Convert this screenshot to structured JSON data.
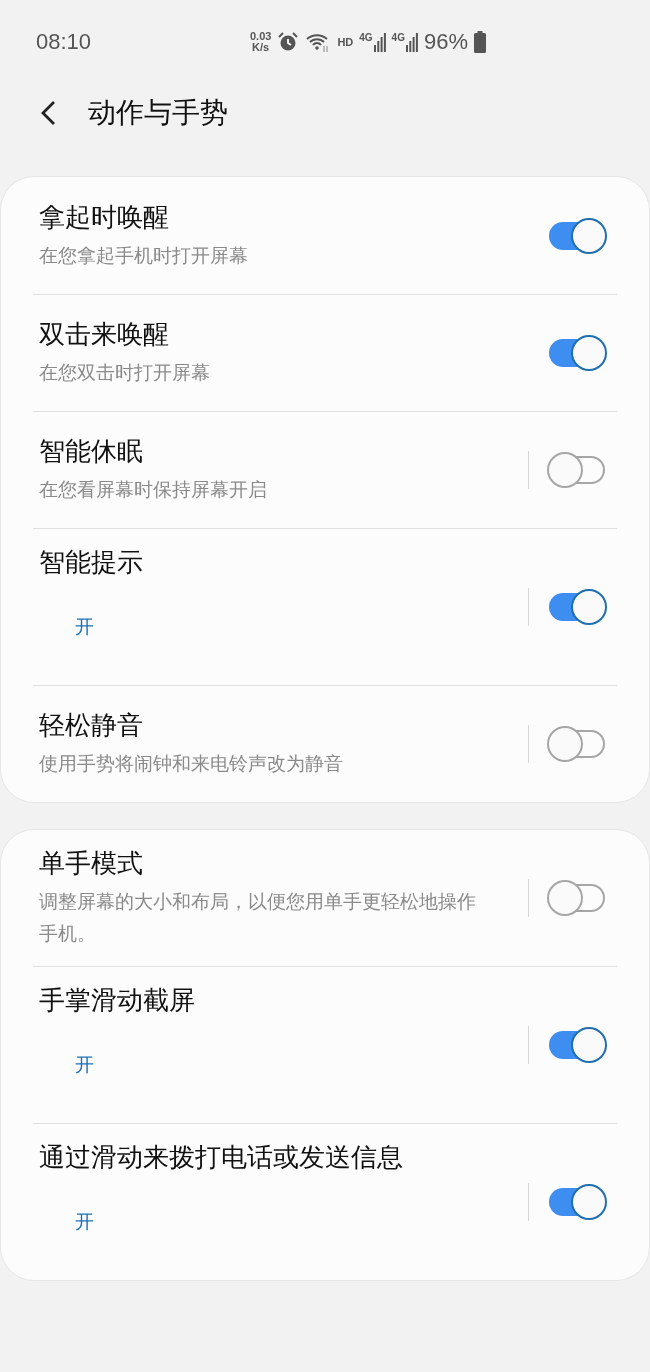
{
  "status_bar": {
    "time": "08:10",
    "net_speed": "0.03",
    "net_unit": "K/s",
    "hd": "HD",
    "sim_labels": [
      "4G",
      "4G"
    ],
    "battery": "96%"
  },
  "header": {
    "title": "动作与手势"
  },
  "groups": [
    {
      "items": [
        {
          "title": "拿起时唤醒",
          "subtitle": "在您拿起手机时打开屏幕",
          "kind": "description",
          "split": false,
          "on": true
        },
        {
          "title": "双击来唤醒",
          "subtitle": "在您双击时打开屏幕",
          "kind": "description",
          "split": false,
          "on": true
        },
        {
          "title": "智能休眠",
          "subtitle": "在您看屏幕时保持屏幕开启",
          "kind": "description",
          "split": true,
          "on": false
        },
        {
          "title": "智能提示",
          "subtitle": "开",
          "kind": "status",
          "split": true,
          "on": true
        },
        {
          "title": "轻松静音",
          "subtitle": "使用手势将闹钟和来电铃声改为静音",
          "kind": "description",
          "split": true,
          "on": false
        }
      ]
    },
    {
      "items": [
        {
          "title": "单手模式",
          "subtitle": "调整屏幕的大小和布局，以便您用单手更轻松地操作手机。",
          "kind": "description",
          "split": true,
          "on": false
        },
        {
          "title": "手掌滑动截屏",
          "subtitle": "开",
          "kind": "status",
          "split": true,
          "on": true
        },
        {
          "title": "通过滑动来拨打电话或发送信息",
          "subtitle": "开",
          "kind": "status",
          "split": true,
          "on": true
        }
      ]
    }
  ]
}
